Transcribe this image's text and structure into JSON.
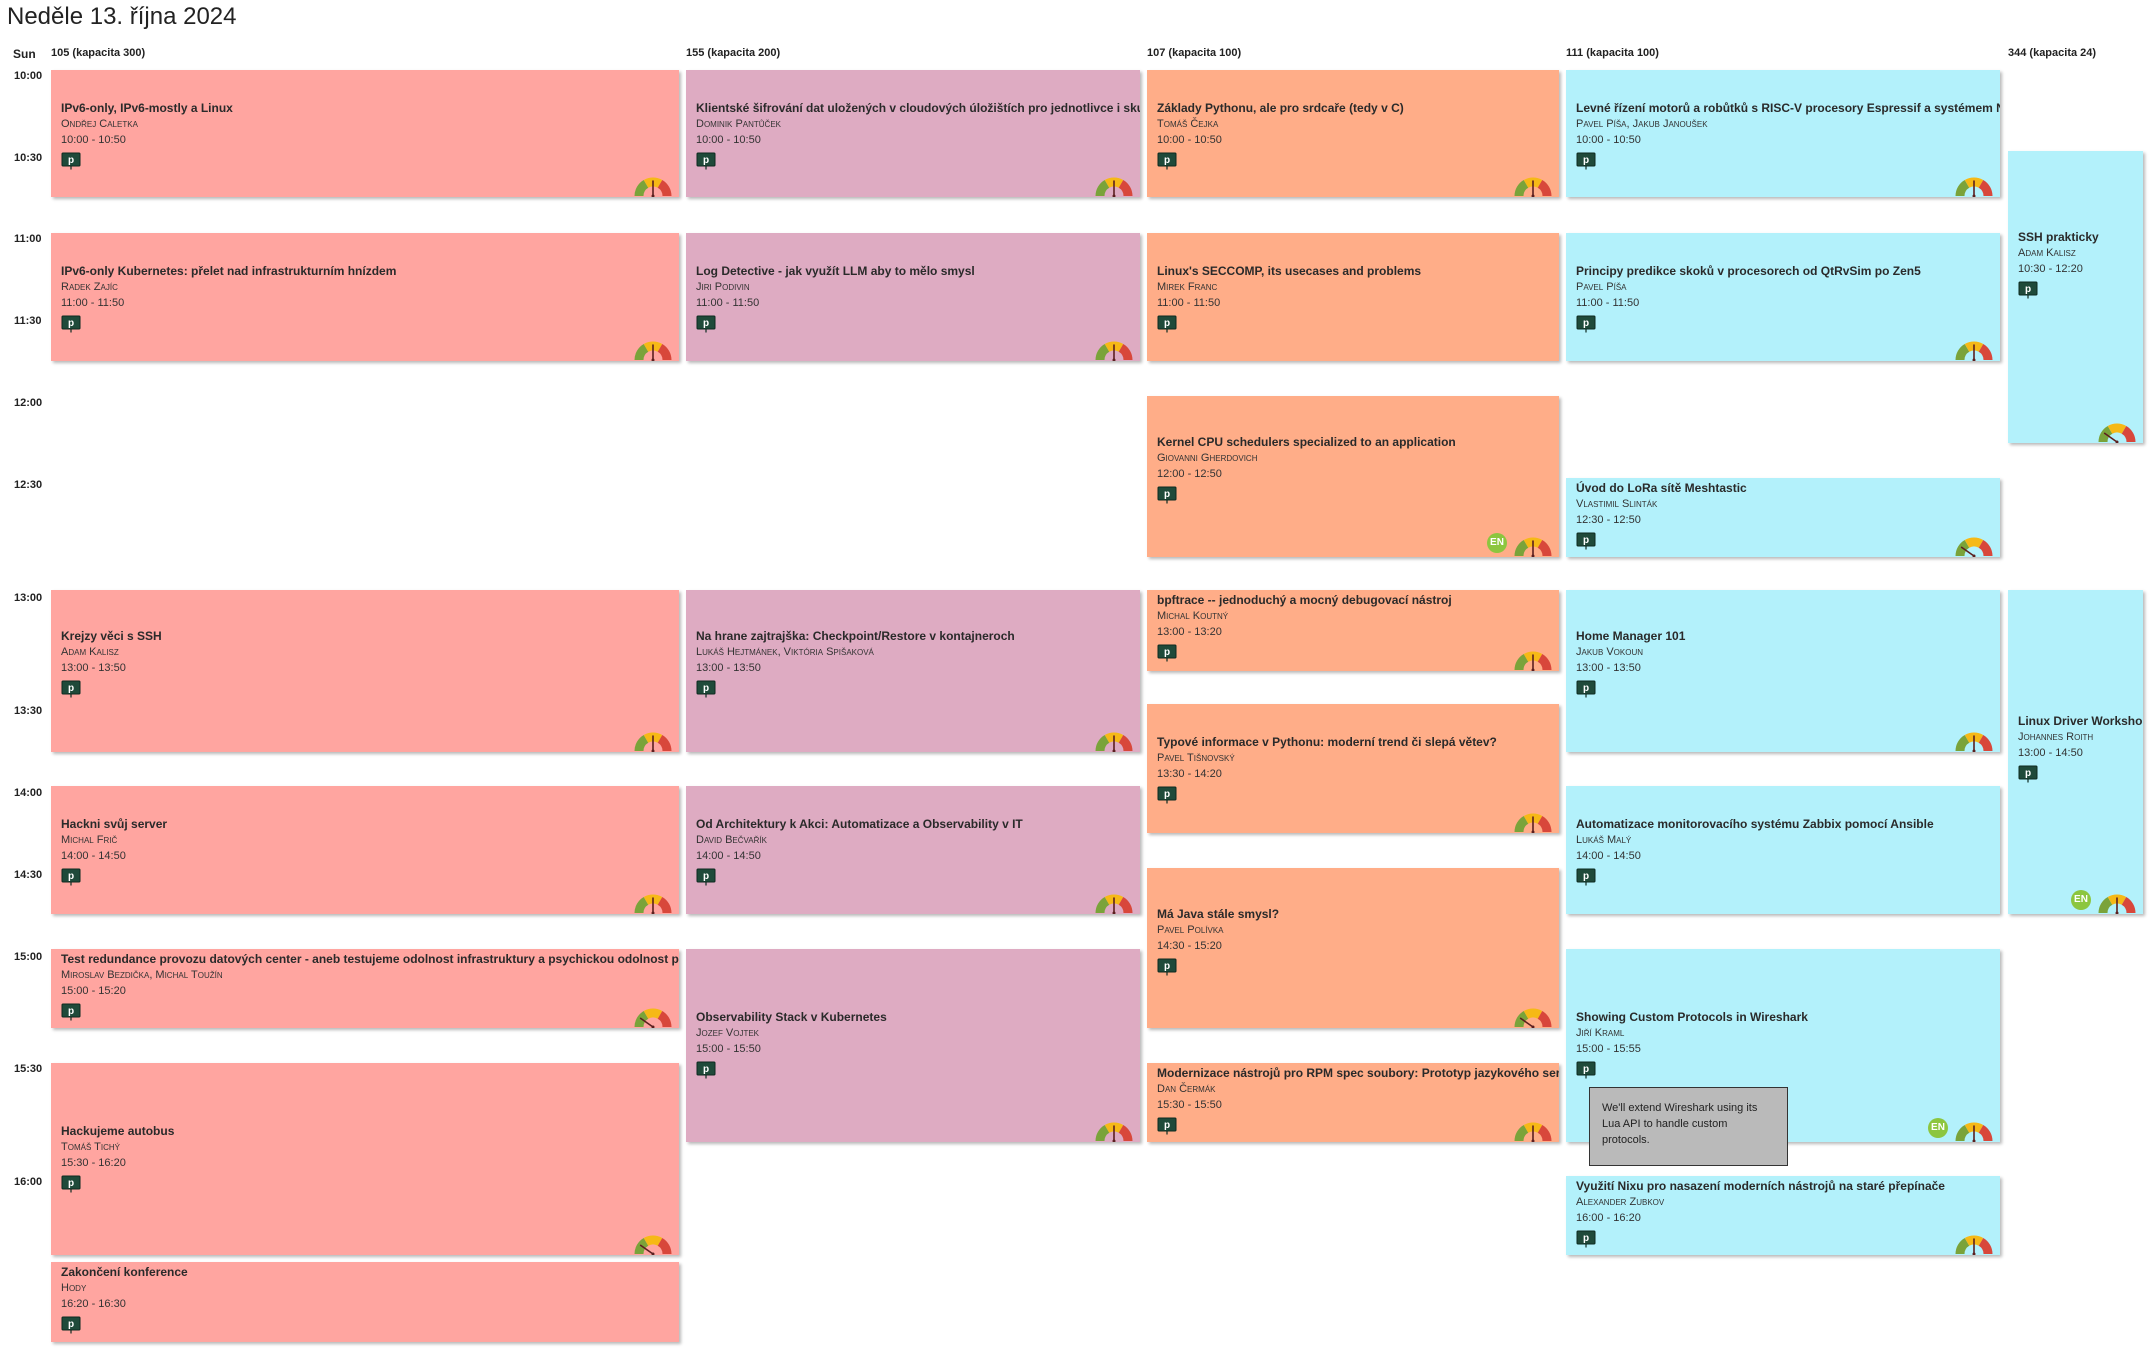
{
  "page": {
    "title": "Neděle 13. října 2024",
    "day_label": "Sun"
  },
  "rooms": [
    {
      "id": "105",
      "label": "105 (kapacita 300)"
    },
    {
      "id": "155",
      "label": "155 (kapacita 200)"
    },
    {
      "id": "107",
      "label": "107 (kapacita 100)"
    },
    {
      "id": "111",
      "label": "111 (kapacita 100)"
    },
    {
      "id": "344",
      "label": "344 (kapacita 24)"
    }
  ],
  "time_slots": [
    "10:00",
    "10:30",
    "11:00",
    "11:30",
    "12:00",
    "12:30",
    "13:00",
    "13:30",
    "14:00",
    "14:30",
    "15:00",
    "15:30",
    "16:00"
  ],
  "colors": {
    "room_105": "#ffa5a0",
    "room_155": "#deabc2",
    "room_107": "#ffad88",
    "room_111": "#b3f1fb",
    "room_344": "#b3f1fb",
    "lang_badge": "#8cc63f",
    "slides_icon": "#1f4a3a"
  },
  "talks": [
    {
      "room": "105",
      "title": "IPv6-only, IPv6-mostly a Linux",
      "speakers": "Ondřej Caletka",
      "time": "10:00 - 10:50",
      "icon": "presentation-icon",
      "level": "intermediate"
    },
    {
      "room": "105",
      "title": "IPv6-only Kubernetes: přelet nad infrastrukturním hnízdem",
      "speakers": "Radek Zajíc",
      "time": "11:00 - 11:50",
      "icon": "presentation-icon",
      "level": "intermediate"
    },
    {
      "room": "105",
      "title": "Krejzy věci s SSH",
      "speakers": "Adam Kalisz",
      "time": "13:00 - 13:50",
      "icon": "presentation-icon",
      "level": "intermediate"
    },
    {
      "room": "105",
      "title": "Hackni svůj server",
      "speakers": "Michal Frič",
      "time": "14:00 - 14:50",
      "icon": "presentation-icon",
      "level": "intermediate"
    },
    {
      "room": "105",
      "title": "Test redundance provozu datových center - aneb testujeme odolnost infrastruktury a psychickou odolnost posádky",
      "speakers": "Miroslav Bezdička, Michal Toužín",
      "time": "15:00 - 15:20",
      "icon": "presentation-icon",
      "level": "beginner"
    },
    {
      "room": "105",
      "title": "Hackujeme autobus",
      "speakers": "Tomáš Tichý",
      "time": "15:30 - 16:20",
      "icon": "presentation-icon",
      "level": "beginner"
    },
    {
      "room": "105",
      "title": "Zakončení konference",
      "speakers": "Hody",
      "time": "16:20 - 16:30",
      "icon": "presentation-icon"
    },
    {
      "room": "155",
      "title": "Klientské šifrování dat uložených v cloudových úložištích pro jednotlivce i skupiny",
      "speakers": "Dominik Pantůček",
      "time": "10:00 - 10:50",
      "icon": "presentation-icon",
      "level": "intermediate"
    },
    {
      "room": "155",
      "title": "Log Detective - jak využít LLM aby to mělo smysl",
      "speakers": "Jiri Podivin",
      "time": "11:00 - 11:50",
      "icon": "presentation-icon",
      "level": "intermediate"
    },
    {
      "room": "155",
      "title": "Na hrane zajtrajška: Checkpoint/Restore v kontajneroch",
      "speakers": "Lukáš Hejtmánek, Viktória Spišaková",
      "time": "13:00 - 13:50",
      "icon": "presentation-icon",
      "level": "intermediate"
    },
    {
      "room": "155",
      "title": "Od Architektury k Akci: Automatizace a Observability v IT",
      "speakers": "David Bečvařík",
      "time": "14:00 - 14:50",
      "icon": "presentation-icon",
      "level": "intermediate"
    },
    {
      "room": "155",
      "title": "Observability Stack v Kubernetes",
      "speakers": "Jozef Vojtek",
      "time": "15:00 - 15:50",
      "icon": "presentation-icon",
      "level": "intermediate"
    },
    {
      "room": "107",
      "title": "Základy Pythonu, ale pro srdcaře (tedy v C)",
      "speakers": "Tomáš Čejka",
      "time": "10:00 - 10:50",
      "icon": "presentation-icon",
      "level": "intermediate"
    },
    {
      "room": "107",
      "title": "Linux's SECCOMP, its usecases and problems",
      "speakers": "Mirek Franc",
      "time": "11:00 - 11:50",
      "icon": "presentation-icon"
    },
    {
      "room": "107",
      "title": "Kernel CPU schedulers specialized to an application",
      "speakers": "Giovanni Gherdovich",
      "time": "12:00 - 12:50",
      "icon": "presentation-icon",
      "lang": "EN",
      "level": "intermediate"
    },
    {
      "room": "107",
      "title": "bpftrace -- jednoduchý a mocný debugovací nástroj",
      "speakers": "Michal Koutný",
      "time": "13:00 - 13:20",
      "icon": "presentation-icon",
      "level": "intermediate"
    },
    {
      "room": "107",
      "title": "Typové informace v Pythonu: moderní trend či slepá větev?",
      "speakers": "Pavel Tišnovský",
      "time": "13:30 - 14:20",
      "icon": "presentation-icon",
      "level": "intermediate"
    },
    {
      "room": "107",
      "title": "Má Java stále smysl?",
      "speakers": "Pavel Polívka",
      "time": "14:30 - 15:20",
      "icon": "presentation-icon",
      "level": "beginner"
    },
    {
      "room": "107",
      "title": "Modernizace nástrojů pro RPM spec soubory: Prototyp jazykového serveru",
      "speakers": "Dan Čermák",
      "time": "15:30 - 15:50",
      "icon": "presentation-icon",
      "level": "intermediate"
    },
    {
      "room": "111",
      "title": "Levné řízení motorů a robůtků s RISC-V procesory Espressif a systémem NuttX",
      "speakers": "Pavel Píša, Jakub Janoušek",
      "time": "10:00 - 10:50",
      "icon": "presentation-icon",
      "level": "intermediate"
    },
    {
      "room": "111",
      "title": "Principy predikce skoků v procesorech od QtRvSim po Zen5",
      "speakers": "Pavel Píša",
      "time": "11:00 - 11:50",
      "icon": "presentation-icon",
      "level": "intermediate"
    },
    {
      "room": "111",
      "title": "Úvod do LoRa sítě Meshtastic",
      "speakers": "Vlastimil Slinták",
      "time": "12:30 - 12:50",
      "icon": "presentation-icon",
      "level": "beginner"
    },
    {
      "room": "111",
      "title": "Home Manager 101",
      "speakers": "Jakub Vokoun",
      "time": "13:00 - 13:50",
      "icon": "presentation-icon",
      "level": "intermediate"
    },
    {
      "room": "111",
      "title": "Automatizace monitorovacího systému Zabbix pomocí Ansible",
      "speakers": "Lukáš Malý",
      "time": "14:00 - 14:50",
      "icon": "presentation-icon"
    },
    {
      "room": "111",
      "title": "Showing Custom Protocols in Wireshark",
      "speakers": "Jiří Kraml",
      "time": "15:00 - 15:55",
      "icon": "presentation-icon",
      "lang": "EN",
      "level": "intermediate"
    },
    {
      "room": "111",
      "title": "Využití Nixu pro nasazení moderních nástrojů na staré přepínače",
      "speakers": "Alexander Zubkov",
      "time": "16:00 - 16:20",
      "icon": "presentation-icon",
      "level": "intermediate"
    },
    {
      "room": "344",
      "title": "SSH prakticky",
      "speakers": "Adam Kalisz",
      "time": "10:30 - 12:20",
      "icon": "presentation-icon",
      "level": "beginner"
    },
    {
      "room": "344",
      "title": "Linux Driver Workshop",
      "speakers": "Johannes Roith",
      "time": "13:00 - 14:50",
      "icon": "presentation-icon",
      "lang": "EN",
      "level": "intermediate"
    }
  ],
  "tooltip": {
    "text": "We'll extend Wireshark using its Lua API to handle custom protocols."
  }
}
